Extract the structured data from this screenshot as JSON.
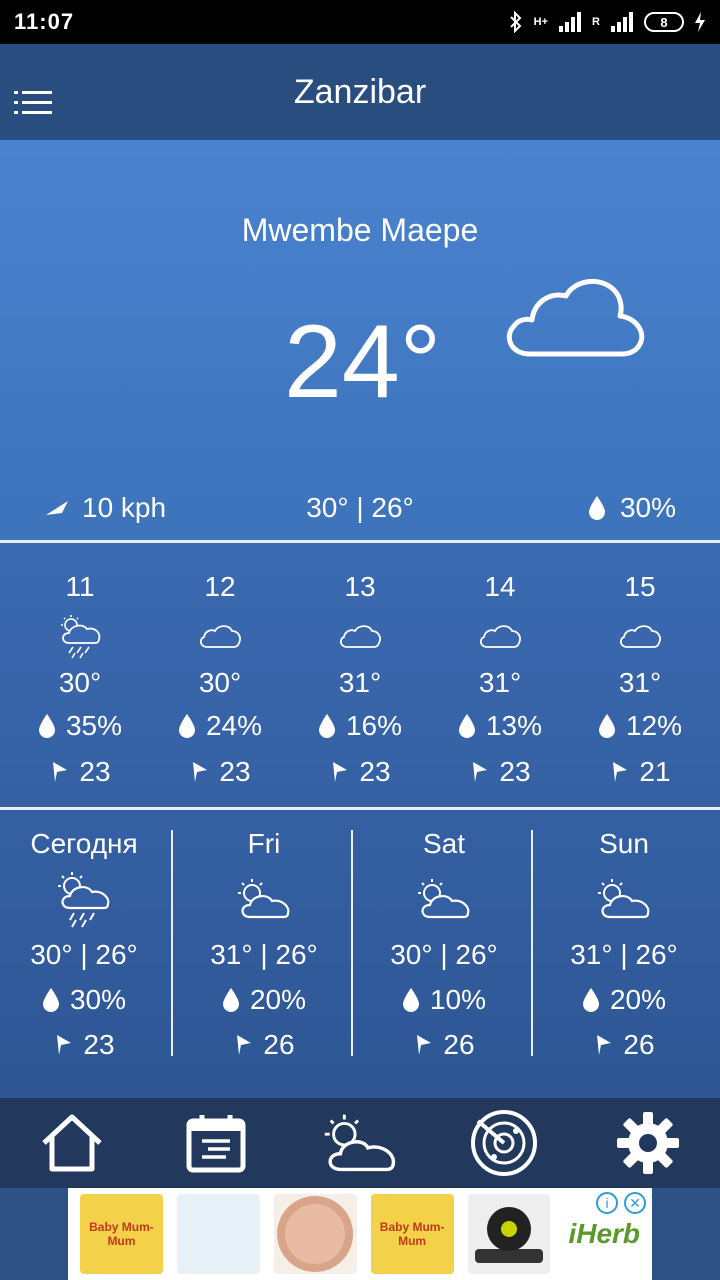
{
  "status_bar": {
    "time": "11:07",
    "network": "H+",
    "sim2": "R",
    "battery": "8"
  },
  "app_bar": {
    "title": "Zanzibar",
    "menu_icon": "menu-icon"
  },
  "current": {
    "place": "Mwembe Maepe",
    "temperature": "24°",
    "condition_icon": "cloud-icon",
    "wind": "10 kph",
    "hi_lo": "30° | 26°",
    "precipitation": "30%"
  },
  "hourly": [
    {
      "hour": "11",
      "icon": "thunderstorm-icon",
      "temp": "30°",
      "precip": "35%",
      "wind": "23"
    },
    {
      "hour": "12",
      "icon": "cloud-icon",
      "temp": "30°",
      "precip": "24%",
      "wind": "23"
    },
    {
      "hour": "13",
      "icon": "cloud-icon",
      "temp": "31°",
      "precip": "16%",
      "wind": "23"
    },
    {
      "hour": "14",
      "icon": "cloud-icon",
      "temp": "31°",
      "precip": "13%",
      "wind": "23"
    },
    {
      "hour": "15",
      "icon": "cloud-icon",
      "temp": "31°",
      "precip": "12%",
      "wind": "21"
    }
  ],
  "daily": [
    {
      "day": "Сегодня",
      "icon": "partly-cloudy-storm-icon",
      "hi_lo": "30° | 26°",
      "precip": "30%",
      "wind": "23"
    },
    {
      "day": "Fri",
      "icon": "partly-cloudy-icon",
      "hi_lo": "31° | 26°",
      "precip": "20%",
      "wind": "26"
    },
    {
      "day": "Sat",
      "icon": "partly-cloudy-icon",
      "hi_lo": "30° | 26°",
      "precip": "10%",
      "wind": "26"
    },
    {
      "day": "Sun",
      "icon": "partly-cloudy-icon",
      "hi_lo": "31° | 26°",
      "precip": "20%",
      "wind": "26"
    }
  ],
  "bottom_nav": [
    {
      "name": "home",
      "icon": "home-icon"
    },
    {
      "name": "forecast",
      "icon": "calendar-icon"
    },
    {
      "name": "weather",
      "icon": "partly-cloudy-icon"
    },
    {
      "name": "radar",
      "icon": "radar-icon"
    },
    {
      "name": "settings",
      "icon": "gear-icon"
    }
  ],
  "ad": {
    "brand": "iHerb",
    "products": [
      {
        "label": "Baby Mum-Mum"
      },
      {
        "label": ""
      },
      {
        "label": ""
      },
      {
        "label": "Baby Mum-Mum"
      },
      {
        "label": ""
      }
    ]
  }
}
